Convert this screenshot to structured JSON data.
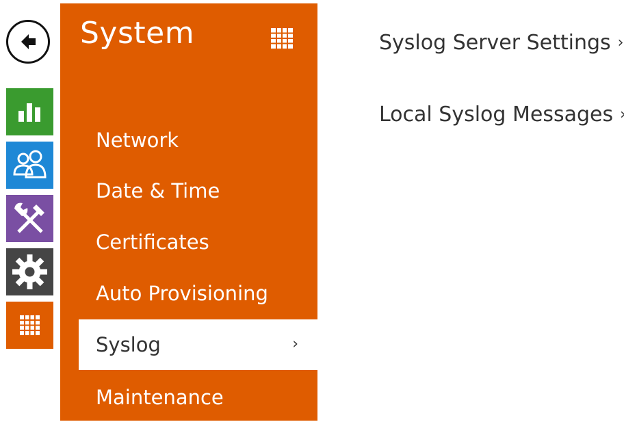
{
  "panel": {
    "title": "System",
    "accent_color": "#df5c00",
    "menu_items": [
      {
        "label": "Network",
        "active": false
      },
      {
        "label": "Date & Time",
        "active": false
      },
      {
        "label": "Certificates",
        "active": false
      },
      {
        "label": "Auto Provisioning",
        "active": false
      },
      {
        "label": "Syslog",
        "active": true,
        "chevron": "›"
      },
      {
        "label": "Maintenance",
        "active": false
      }
    ]
  },
  "rail": {
    "items": [
      {
        "icon": "status-chart-icon",
        "color": "#3a9b2f"
      },
      {
        "icon": "directory-users-icon",
        "color": "#1e88d6"
      },
      {
        "icon": "hardware-tools-icon",
        "color": "#7a4fa3"
      },
      {
        "icon": "system-gear-icon",
        "color": "#454545"
      },
      {
        "icon": "apps-grid-icon",
        "color": "#df5c00"
      }
    ]
  },
  "content": {
    "links": [
      {
        "label": "Syslog Server Settings",
        "chevron": "›"
      },
      {
        "label": "Local Syslog Messages",
        "chevron": "›"
      }
    ]
  }
}
